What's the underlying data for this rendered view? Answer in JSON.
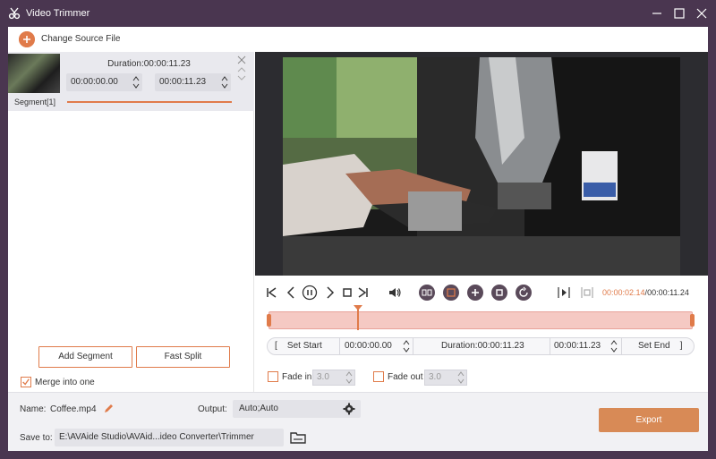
{
  "window": {
    "title": "Video Trimmer"
  },
  "source_bar": {
    "change_source_label": "Change Source File"
  },
  "segment": {
    "duration_label": "Duration:00:00:11.23",
    "start_time": "00:00:00.00",
    "end_time": "00:00:11.23",
    "label": "Segment[1]"
  },
  "left_buttons": {
    "add_segment": "Add Segment",
    "fast_split": "Fast Split",
    "merge_label": "Merge into one",
    "merge_checked": true
  },
  "playback": {
    "current_time": "00:00:02.14",
    "separator": "/",
    "total_time": "00:00:11.24",
    "playhead_fraction": 0.21
  },
  "trim_row": {
    "set_start": "Set Start",
    "start_time": "00:00:00.00",
    "duration": "Duration:00:00:11.23",
    "end_time": "00:00:11.23",
    "set_end": "Set End"
  },
  "fade": {
    "fade_in_label": "Fade in",
    "fade_in_value": "3.0",
    "fade_out_label": "Fade out",
    "fade_out_value": "3.0"
  },
  "bottom": {
    "name_label": "Name:",
    "name_value": "Coffee.mp4",
    "output_label": "Output:",
    "output_value": "Auto;Auto",
    "save_label": "Save to:",
    "save_path": "E:\\AVAide Studio\\AVAid...ideo Converter\\Trimmer",
    "export_label": "Export"
  },
  "colors": {
    "accent": "#e07b4a",
    "titlebar": "#4a3650",
    "timeline_fill": "#f5c9c3"
  }
}
